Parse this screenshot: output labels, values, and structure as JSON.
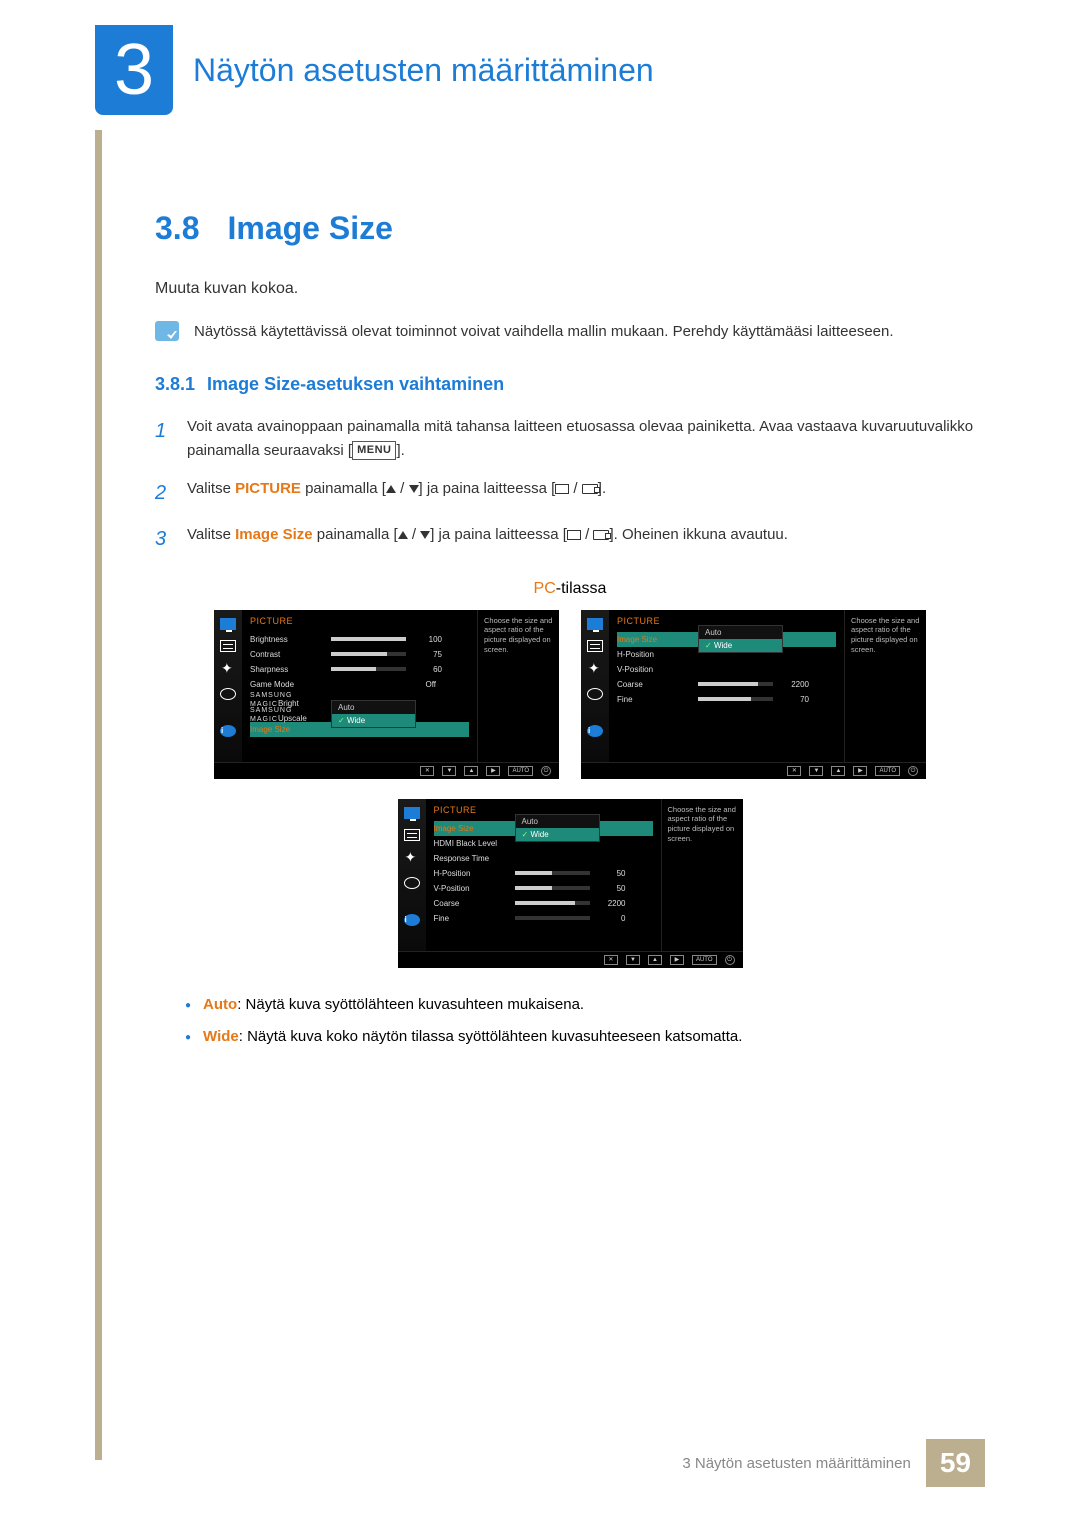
{
  "header": {
    "chapter_number": "3",
    "chapter_title": "Näytön asetusten määrittäminen"
  },
  "section": {
    "number": "3.8",
    "title": "Image Size",
    "intro": "Muuta kuvan kokoa.",
    "info_note": "Näytössä käytettävissä olevat toiminnot voivat vaihdella mallin mukaan. Perehdy käyttämääsi laitteeseen."
  },
  "subsection": {
    "number": "3.8.1",
    "title": "Image Size-asetuksen vaihtaminen"
  },
  "steps": [
    {
      "num": "1",
      "pre": "Voit avata avainoppaan painamalla mitä tahansa laitteen etuosassa olevaa painiketta. Avaa vastaava kuvaruutuvalikko painamalla seuraavaksi [",
      "menu": "MENU",
      "post": "]."
    },
    {
      "num": "2",
      "pre": "Valitse ",
      "hl": "PICTURE",
      "mid": " painamalla [",
      "post_mid": "] ja paina laitteessa [",
      "end": "]."
    },
    {
      "num": "3",
      "pre": "Valitse ",
      "hl": "Image Size",
      "mid": " painamalla [",
      "post_mid": "] ja paina laitteessa [",
      "end": "]. Oheinen ikkuna avautuu."
    }
  ],
  "mode_label_pc": "PC",
  "mode_label_suffix": "-tilassa",
  "osd": {
    "title": "PICTURE",
    "desc": "Choose the size and aspect ratio of the picture displayed on screen.",
    "panel1": [
      {
        "label": "Brightness",
        "val": "100",
        "pct": 100
      },
      {
        "label": "Contrast",
        "val": "75",
        "pct": 75
      },
      {
        "label": "Sharpness",
        "val": "60",
        "pct": 60
      },
      {
        "label": "Game Mode",
        "val": "Off"
      },
      {
        "label_magic": "SAMSUNG",
        "label_sub": "MAGIC",
        "label_end": "Bright"
      },
      {
        "label_magic": "SAMSUNG",
        "label_sub": "MAGIC",
        "label_end": "Upscale",
        "dd": {
          "opts": [
            "Auto",
            "Wide"
          ],
          "sel": 1
        }
      },
      {
        "label": "Image Size",
        "hl": true
      }
    ],
    "panel2": [
      {
        "label": "Image Size",
        "hl": true,
        "dd": {
          "opts": [
            "Auto",
            "Wide"
          ],
          "sel": 1
        }
      },
      {
        "label": "H-Position"
      },
      {
        "label": "V-Position"
      },
      {
        "label": "Coarse",
        "val": "2200",
        "pct": 80
      },
      {
        "label": "Fine",
        "val": "70",
        "pct": 70
      }
    ],
    "panel3": [
      {
        "label": "Image Size",
        "hl": true,
        "dd": {
          "opts": [
            "Auto",
            "Wide"
          ],
          "sel": 1
        }
      },
      {
        "label": "HDMI Black Level"
      },
      {
        "label": "Response Time"
      },
      {
        "label": "H-Position",
        "val": "50",
        "pct": 50
      },
      {
        "label": "V-Position",
        "val": "50",
        "pct": 50
      },
      {
        "label": "Coarse",
        "val": "2200",
        "pct": 80
      },
      {
        "label": "Fine",
        "val": "0",
        "pct": 0
      }
    ],
    "footer_auto": "AUTO"
  },
  "bullets": [
    {
      "term": "Auto",
      "text": ": Näytä kuva syöttölähteen kuvasuhteen mukaisena."
    },
    {
      "term": "Wide",
      "text": ": Näytä kuva koko näytön tilassa syöttölähteen kuvasuhteeseen katsomatta."
    }
  ],
  "footer": {
    "text": "3 Näytön asetusten määrittäminen",
    "page": "59"
  }
}
